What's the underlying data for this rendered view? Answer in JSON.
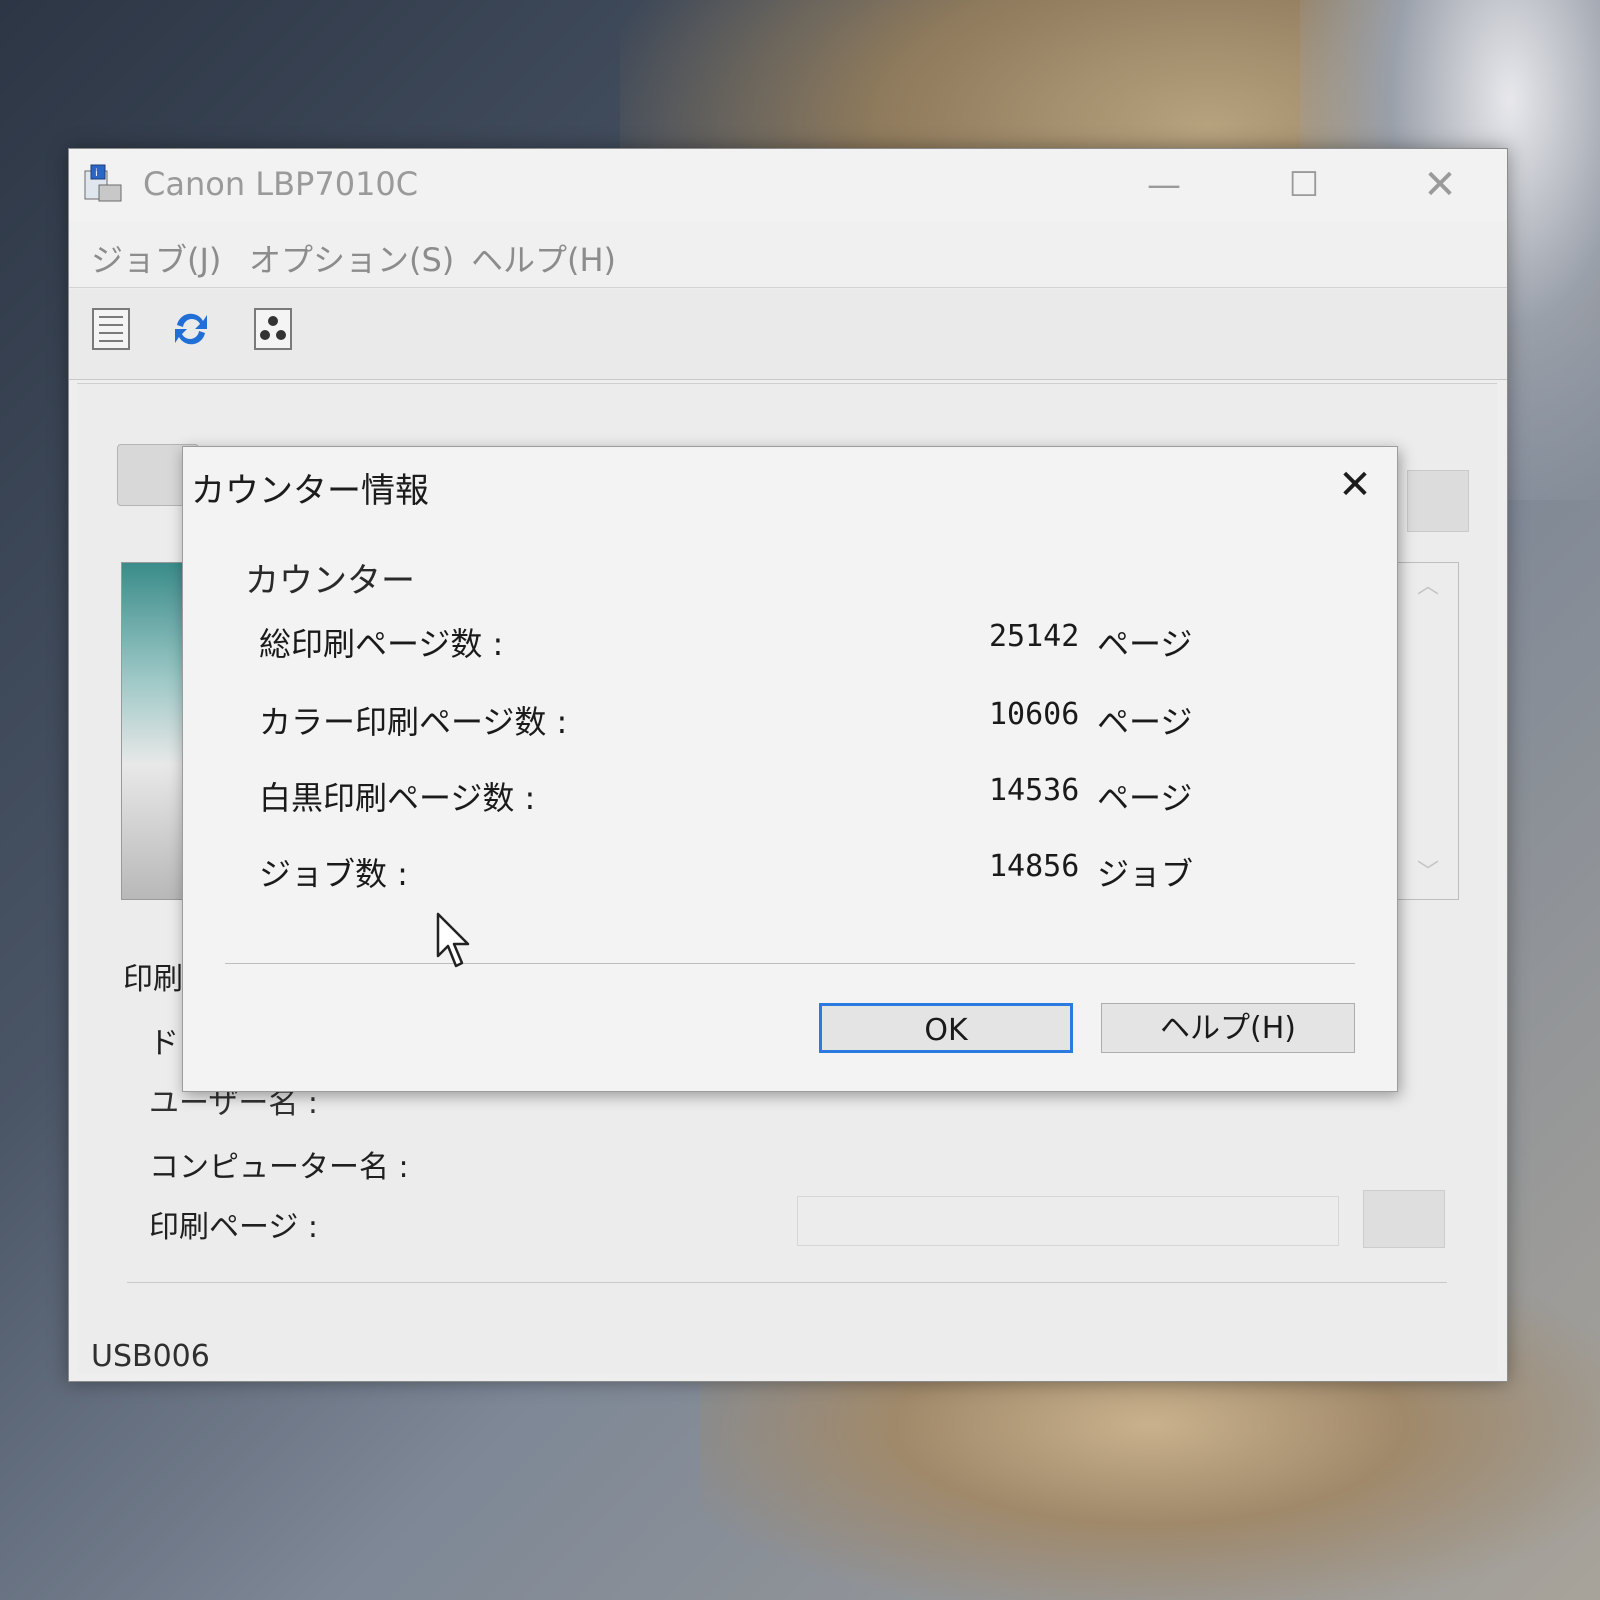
{
  "window": {
    "title": "Canon LBP7010C",
    "minimize": "—",
    "maximize": "☐",
    "close": "✕"
  },
  "menu": {
    "job": "ジョブ(J)",
    "options": "オプション(S)",
    "help": "ヘルプ(H)"
  },
  "toolbar_icons": [
    "job-list-icon",
    "refresh-icon",
    "toner-icon"
  ],
  "background_panel": {
    "print_label": "印刷",
    "doc_label": "ド",
    "user_label": "ユーザー名 :",
    "computer_label": "コンピューター名 :",
    "pages_label": "印刷ページ :",
    "scroll_up": "︿",
    "scroll_down": "﹀"
  },
  "status_bar": {
    "port": "USB006"
  },
  "dialog": {
    "title": "カウンター情報",
    "close": "✕",
    "group": "カウンター",
    "rows": [
      {
        "label": "総印刷ページ数 :",
        "value": "25142",
        "unit": "ページ"
      },
      {
        "label": "カラー印刷ページ数 :",
        "value": "10606",
        "unit": "ページ"
      },
      {
        "label": "白黒印刷ページ数 :",
        "value": "14536",
        "unit": "ページ"
      },
      {
        "label": "ジョブ数 :",
        "value": "14856",
        "unit": "ジョブ"
      }
    ],
    "ok_label": "OK",
    "help_label": "ヘルプ(H)"
  },
  "colors": {
    "ok_focus_border": "#2a7be0",
    "refresh_icon_blue": "#1f6fd6"
  }
}
